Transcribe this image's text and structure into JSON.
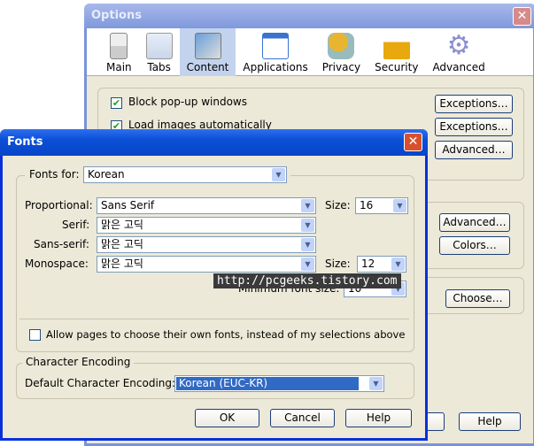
{
  "options": {
    "title": "Options",
    "tabs": [
      {
        "label": "Main",
        "icon": "main-icon"
      },
      {
        "label": "Tabs",
        "icon": "tabs-icon"
      },
      {
        "label": "Content",
        "icon": "content-icon",
        "selected": true
      },
      {
        "label": "Applications",
        "icon": "applications-icon"
      },
      {
        "label": "Privacy",
        "icon": "privacy-icon"
      },
      {
        "label": "Security",
        "icon": "lock-icon"
      },
      {
        "label": "Advanced",
        "icon": "gear-icon"
      }
    ],
    "block_popups": "Block pop-up windows",
    "load_images": "Load images automatically",
    "exceptions": "Exceptions…",
    "advanced": "Advanced…",
    "advanced2": "Advanced…",
    "colors": "Colors…",
    "choose": "Choose…",
    "help": "Help"
  },
  "fonts": {
    "title": "Fonts",
    "fonts_for_label": "Fonts for:",
    "fonts_for": "Korean",
    "proportional_label": "Proportional:",
    "proportional": "Sans Serif",
    "size_label": "Size:",
    "prop_size": "16",
    "serif_label": "Serif:",
    "serif": "맑은 고딕",
    "sans_label": "Sans-serif:",
    "sans": "맑은 고딕",
    "mono_label": "Monospace:",
    "mono": "맑은 고딕",
    "mono_size": "12",
    "min_label": "Minimum font size:",
    "min_size": "10",
    "allow": "Allow pages to choose their own fonts, instead of my selections above",
    "enc_group": "Character Encoding",
    "enc_label": "Default Character Encoding:",
    "encoding": "Korean (EUC-KR)",
    "ok": "OK",
    "cancel": "Cancel",
    "help": "Help"
  },
  "watermark": "http://pcgeeks.tistory.com"
}
